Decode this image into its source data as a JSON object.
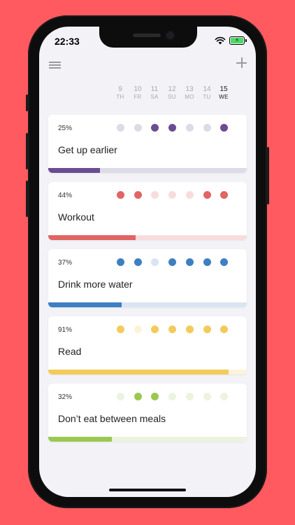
{
  "status": {
    "time": "22:33"
  },
  "days": [
    {
      "num": "9",
      "abbr": "TH",
      "today": false
    },
    {
      "num": "10",
      "abbr": "FR",
      "today": false
    },
    {
      "num": "11",
      "abbr": "SA",
      "today": false
    },
    {
      "num": "12",
      "abbr": "SU",
      "today": false
    },
    {
      "num": "13",
      "abbr": "MO",
      "today": false
    },
    {
      "num": "14",
      "abbr": "TU",
      "today": false
    },
    {
      "num": "15",
      "abbr": "WE",
      "today": true
    }
  ],
  "habits": [
    {
      "name": "Get up earlier",
      "percent_label": "25%",
      "progress": 0.26,
      "color": "#6a4c93",
      "light": "#dcdbe6",
      "done": [
        false,
        false,
        true,
        true,
        false,
        false,
        true
      ]
    },
    {
      "name": "Workout",
      "percent_label": "44%",
      "progress": 0.44,
      "color": "#e06563",
      "light": "#f8dcdc",
      "done": [
        true,
        true,
        false,
        false,
        false,
        true,
        true
      ]
    },
    {
      "name": "Drink more water",
      "percent_label": "37%",
      "progress": 0.37,
      "color": "#3e7fc1",
      "light": "#d9e5f2",
      "done": [
        true,
        true,
        false,
        true,
        true,
        true,
        true
      ]
    },
    {
      "name": "Read",
      "percent_label": "91%",
      "progress": 0.91,
      "color": "#f3cb5b",
      "light": "#fdf3dc",
      "done": [
        true,
        false,
        true,
        true,
        true,
        true,
        true
      ]
    },
    {
      "name": "Don’t eat between meals",
      "percent_label": "32%",
      "progress": 0.32,
      "color": "#9bc850",
      "light": "#ecf3df",
      "done": [
        false,
        true,
        true,
        false,
        false,
        false,
        false
      ]
    }
  ]
}
